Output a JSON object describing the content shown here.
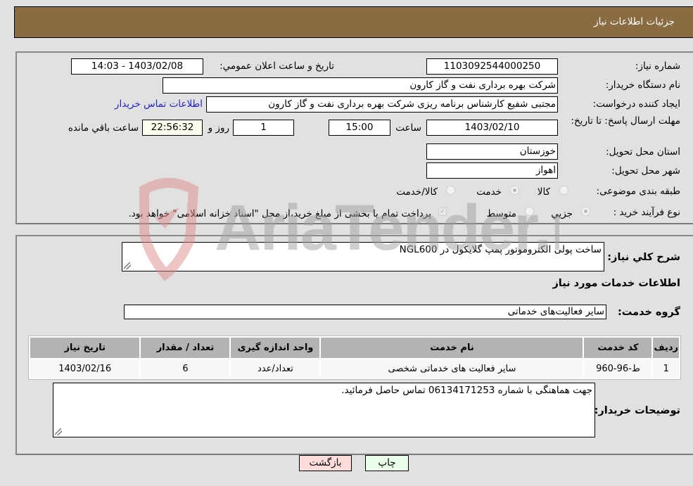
{
  "header": {
    "title": "جزئیات اطلاعات نیاز"
  },
  "details": {
    "need_number": {
      "label": "شماره نیاز:",
      "value": "1103092544000250"
    },
    "announce_datetime": {
      "label": "تاریخ و ساعت اعلان عمومي:",
      "value": "1403/02/08 - 14:03"
    },
    "buyer_org": {
      "label": "نام دستگاه خریدار:",
      "value": "شرکت بهره برداری نفت و گاز کارون"
    },
    "requester": {
      "label": "ایجاد کننده درخواست:",
      "value": "مجتبی شفیع کارشناس برنامه ریزی شرکت بهره برداری نفت و گاز کارون"
    },
    "buyer_contact_link": "اطلاعات تماس خریدار",
    "deadline": {
      "label": "مهلت ارسال پاسخ: تا تاریخ:",
      "date": "1403/02/10",
      "time_label": "ساعت",
      "time": "15:00",
      "days": "1",
      "days_label": "روز و",
      "remaining": "22:56:32",
      "remaining_label": "ساعت باقي مانده"
    },
    "province": {
      "label": "استان محل تحویل:",
      "value": "خوزستان"
    },
    "city": {
      "label": "شهر محل تحویل:",
      "value": "اهواز"
    },
    "category": {
      "label": "طبقه بندی موضوعی:",
      "options": [
        "کالا",
        "خدمت",
        "کالا/خدمت"
      ],
      "selected": "خدمت"
    },
    "purchase_type": {
      "label": "نوع فرآیند خرید :",
      "options": [
        "جزيي",
        "متوسط"
      ],
      "selected": "جزيي",
      "treasury_note": "پرداخت تمام یا بخشی از مبلغ خرید،از محل \"اسناد خزانه اسلامی\" خواهد بود."
    }
  },
  "summary": {
    "label": "شرح كلي نياز:",
    "value": "ساخت پولی الکتروموتور پمپ گلایکول در NGL600"
  },
  "services": {
    "section_title": "اطلاعات خدمات مورد نیاز",
    "group_label": "گروه خدمت:",
    "group_value": "سایر فعالیت‌های خدماتی",
    "table": {
      "headers": [
        "ردیف",
        "کد خدمت",
        "نام خدمت",
        "واحد اندازه گیری",
        "تعداد / مقدار",
        "تاریخ نیاز"
      ],
      "rows": [
        [
          "1",
          "ط-96-960",
          "سایر فعالیت های خدماتی شخصی",
          "تعداد/عدد",
          "6",
          "1403/02/16"
        ]
      ]
    }
  },
  "buyer_notes": {
    "label": "توضیحات خریدار:",
    "value": "جهت هماهنگی با شماره 06134171253 تماس حاصل فرمائید."
  },
  "buttons": {
    "print": "چاپ",
    "back": "بازگشت"
  },
  "colors": {
    "header_bg": "#8b6c42",
    "print_bg": "#eaffea",
    "back_bg": "#ffdcdc",
    "link": "#2222cc"
  },
  "watermark": "AriaTender.neT"
}
